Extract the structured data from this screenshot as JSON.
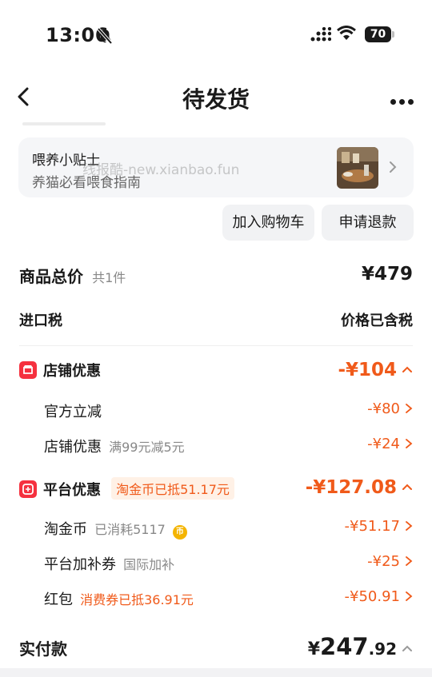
{
  "status_bar": {
    "time": "13:06",
    "battery": "70"
  },
  "nav": {
    "title": "待发货"
  },
  "tips": {
    "title": "喂养小贴士",
    "subtitle": "养猫必看喂食指南",
    "watermark": "线报酷-new.xianbao.fun"
  },
  "actions": {
    "add_to_cart": "加入购物车",
    "refund": "申请退款"
  },
  "summary": {
    "total_label": "商品总价",
    "total_count": "共1件",
    "total_value": "¥479",
    "tax_label": "进口税",
    "tax_value": "价格已含税"
  },
  "shop_discount": {
    "label": "店铺优惠",
    "value": "-¥104",
    "items": [
      {
        "label": "官方立减",
        "note": "",
        "value": "-¥80"
      },
      {
        "label": "店铺优惠",
        "note": "满99元减5元",
        "value": "-¥24"
      }
    ]
  },
  "platform_discount": {
    "label": "平台优惠",
    "tag": "淘金币已抵51.17元",
    "value": "-¥127.08",
    "items": [
      {
        "label": "淘金币",
        "note": "已消耗5117",
        "value": "-¥51.17"
      },
      {
        "label": "平台加补券",
        "note": "国际加补",
        "value": "-¥25"
      },
      {
        "label": "红包",
        "note": "消费券已抵36.91元",
        "value": "-¥50.91"
      }
    ]
  },
  "payment": {
    "label": "实付款",
    "currency": "¥",
    "integer": "247",
    "decimal": ".92"
  },
  "colors": {
    "accent": "#f05a1a",
    "shop_icon": "#f5313f",
    "coin": "#f4b400"
  }
}
